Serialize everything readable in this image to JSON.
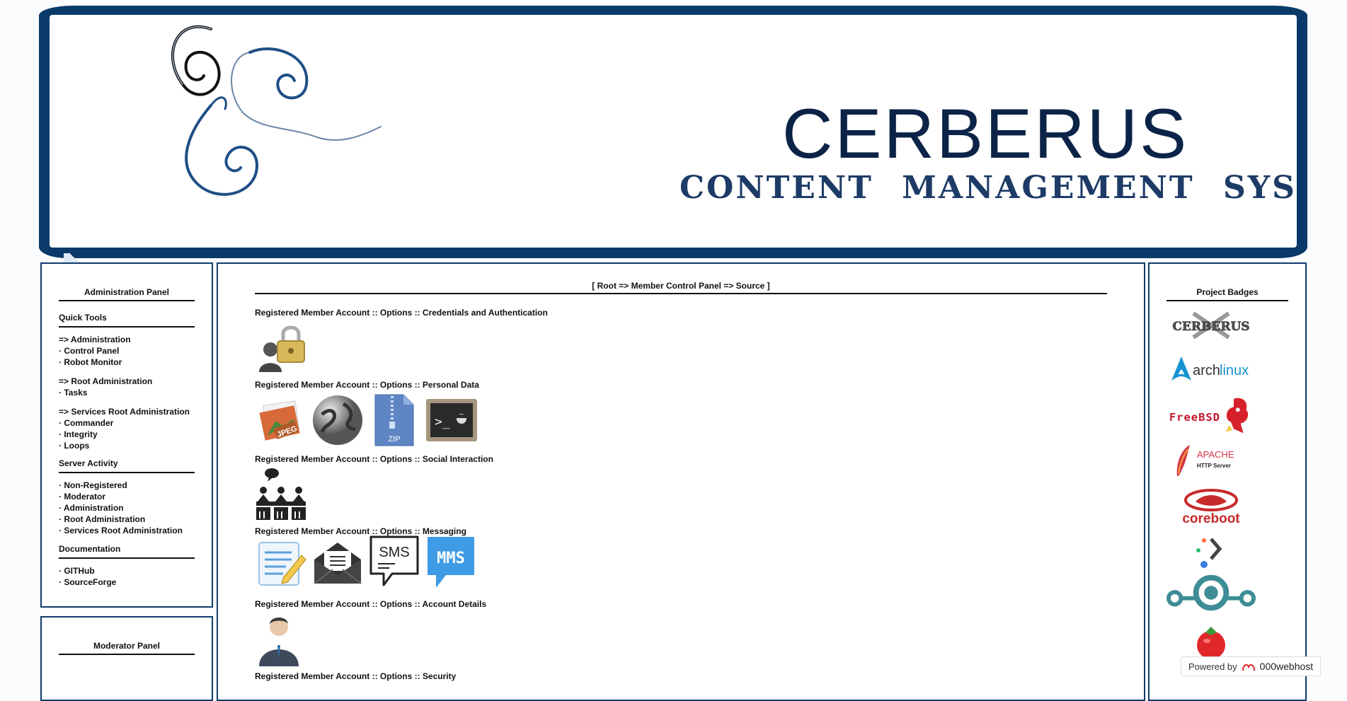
{
  "banner": {
    "title": "CERBERUS",
    "subtitle": "CONTENT MANAGEMENT SYSTEM"
  },
  "left_panel": {
    "title": "Administration Panel",
    "sections": [
      {
        "title": "Quick Tools",
        "groups": [
          [
            "=> Administration",
            "· Control Panel",
            "· Robot Monitor"
          ],
          [
            "=> Root Administration",
            "· Tasks"
          ],
          [
            "=> Services Root Administration",
            "· Commander",
            "· Integrity",
            "· Loops"
          ]
        ]
      },
      {
        "title": "Server Activity",
        "groups": [
          [
            "· Non-Registered",
            "· Moderator",
            "· Administration",
            "· Root Administration",
            "· Services Root Administration"
          ]
        ]
      },
      {
        "title": "Documentation",
        "groups": [
          [
            "· GITHub",
            "· SourceForge"
          ]
        ]
      }
    ]
  },
  "moderator_panel": {
    "title": "Moderator Panel"
  },
  "center": {
    "breadcrumb": "[ Root => Member Control Panel => Source ]",
    "options": [
      {
        "title": "Registered Member Account :: Options :: Credentials and Authentication",
        "icons": [
          "user-lock-icon"
        ]
      },
      {
        "title": "Registered Member Account :: Options :: Personal Data",
        "icons": [
          "image-jpeg-icon",
          "globe-icon",
          "zip-file-icon",
          "terminal-icon"
        ]
      },
      {
        "title": "Registered Member Account :: Options :: Social Interaction",
        "icons": [
          "people-chat-icon"
        ]
      },
      {
        "title": "Registered Member Account :: Options :: Messaging",
        "icons": [
          "note-edit-icon",
          "envelope-icon",
          "sms-icon",
          "mms-icon"
        ]
      },
      {
        "title": "Registered Member Account :: Options :: Account Details",
        "icons": [
          "businessman-icon"
        ]
      },
      {
        "title": "Registered Member Account :: Options :: Security",
        "icons": []
      }
    ],
    "icon_text": {
      "jpeg": "JPEG",
      "zip": "ZIP",
      "terminal": ">_",
      "sms": "SMS",
      "mms": "MMS"
    }
  },
  "right_panel": {
    "title": "Project Badges",
    "badges": [
      {
        "name": "cerberus-badge",
        "text": "CERBERUS"
      },
      {
        "name": "archlinux-badge",
        "text_a": "arch",
        "text_b": "linux"
      },
      {
        "name": "freebsd-badge",
        "text": "FreeBSD"
      },
      {
        "name": "apache-badge",
        "text_a": "APACHE",
        "text_b": "HTTP Server"
      },
      {
        "name": "coreboot-badge",
        "text": "coreboot"
      },
      {
        "name": "dots-badge"
      },
      {
        "name": "lineageos-badge"
      },
      {
        "name": "tomato-badge"
      }
    ]
  },
  "powered": {
    "label": "Powered by",
    "brand": "000webhost"
  },
  "colors": {
    "banner_blue": "#0a3a6a",
    "panel_border": "#0f3c6b",
    "title_navy": "#0c2348"
  }
}
